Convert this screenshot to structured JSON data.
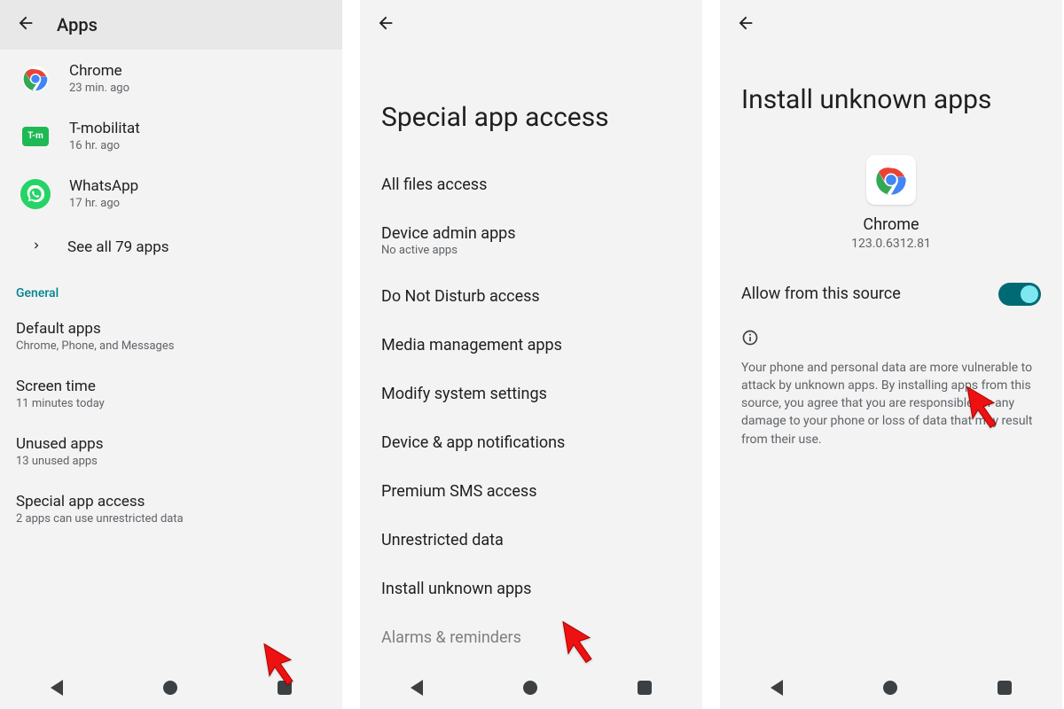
{
  "screen1": {
    "title": "Apps",
    "apps": [
      {
        "name": "Chrome",
        "sub": "23 min. ago",
        "icon": "chrome"
      },
      {
        "name": "T-mobilitat",
        "sub": "16 hr. ago",
        "icon": "tmobilitat",
        "badge": "T-m"
      },
      {
        "name": "WhatsApp",
        "sub": "17 hr. ago",
        "icon": "whatsapp"
      }
    ],
    "see_all": "See all 79 apps",
    "section": "General",
    "settings": [
      {
        "title": "Default apps",
        "sub": "Chrome, Phone, and Messages"
      },
      {
        "title": "Screen time",
        "sub": "11 minutes today"
      },
      {
        "title": "Unused apps",
        "sub": "13 unused apps"
      },
      {
        "title": "Special app access",
        "sub": "2 apps can use unrestricted data"
      }
    ]
  },
  "screen2": {
    "title": "Special app access",
    "items": [
      {
        "t": "All files access"
      },
      {
        "t": "Device admin apps",
        "s": "No active apps"
      },
      {
        "t": "Do Not Disturb access"
      },
      {
        "t": "Media management apps"
      },
      {
        "t": "Modify system settings"
      },
      {
        "t": "Device & app notifications"
      },
      {
        "t": "Premium SMS access"
      },
      {
        "t": "Unrestricted data"
      },
      {
        "t": "Install unknown apps"
      },
      {
        "t": "Alarms & reminders"
      }
    ]
  },
  "screen3": {
    "title": "Install unknown apps",
    "app_name": "Chrome",
    "app_version": "123.0.6312.81",
    "toggle_label": "Allow from this source",
    "toggle_on": true,
    "warning": "Your phone and personal data are more vulnerable to attack by unknown apps. By installing apps from this source, you agree that you are responsible for any damage to your phone or loss of data that may result from their use."
  }
}
